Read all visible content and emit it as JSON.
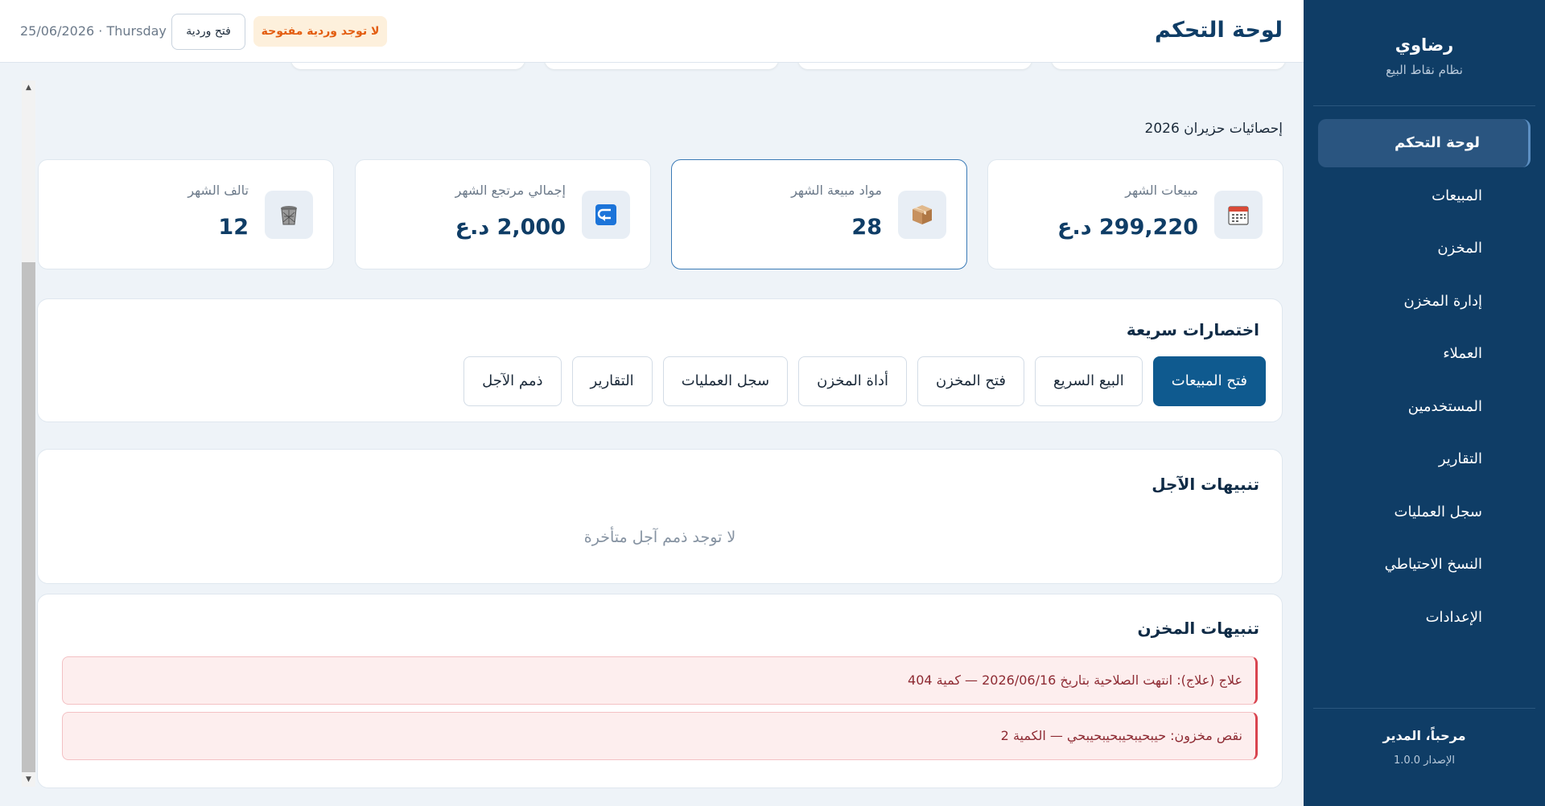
{
  "sidebar": {
    "brand": "رضاوي",
    "subtitle": "نظام نقاط البيع",
    "items": [
      {
        "label": "لوحة التحكم",
        "active": true
      },
      {
        "label": "المبيعات"
      },
      {
        "label": "المخزن"
      },
      {
        "label": "إدارة المخزن"
      },
      {
        "label": "العملاء"
      },
      {
        "label": "المستخدمين"
      },
      {
        "label": "التقارير"
      },
      {
        "label": "سجل العمليات"
      },
      {
        "label": "النسخ الاحتياطي"
      },
      {
        "label": "الإعدادات"
      }
    ],
    "welcome": "مرحباً، المدير",
    "version": "الإصدار 1.0.0"
  },
  "header": {
    "title": "لوحة التحكم",
    "shift_status": "لا توجد وردية مفتوحة",
    "open_shift_button": "فتح وردية",
    "date": "25/06/2026 · Thursday"
  },
  "stats": {
    "section_title": "إحصائيات حزيران 2026",
    "cards": [
      {
        "label": "مبيعات الشهر",
        "value": "299,220 د.ع",
        "icon": "calendar-icon"
      },
      {
        "label": "مواد مبيعة الشهر",
        "value": "28",
        "icon": "package-icon"
      },
      {
        "label": "إجمالي مرتجع الشهر",
        "value": "2,000 د.ع",
        "icon": "return-icon"
      },
      {
        "label": "تالف الشهر",
        "value": "12",
        "icon": "trash-icon"
      }
    ]
  },
  "shortcuts": {
    "title": "اختصارات سريعة",
    "buttons": [
      "فتح المبيعات",
      "البيع السريع",
      "فتح المخزن",
      "أداة المخزن",
      "سجل العمليات",
      "التقارير",
      "ذمم الآجل"
    ]
  },
  "deferred_alerts": {
    "title": "تنبيهات الآجل",
    "empty_message": "لا توجد ذمم آجل متأخرة"
  },
  "stock_alerts": {
    "title": "تنبيهات المخزن",
    "items": [
      "علاج (علاج): انتهت الصلاحية بتاريخ 2026/06/16 — كمية 404",
      "نقص مخزون: حيبحيبحيبحيبحيبحي — الكمية 2"
    ]
  },
  "colors": {
    "sidebar_bg": "#0f3d66",
    "primary": "#0f5a8f",
    "warning": "#e35d10",
    "alert": "#d9444f"
  }
}
